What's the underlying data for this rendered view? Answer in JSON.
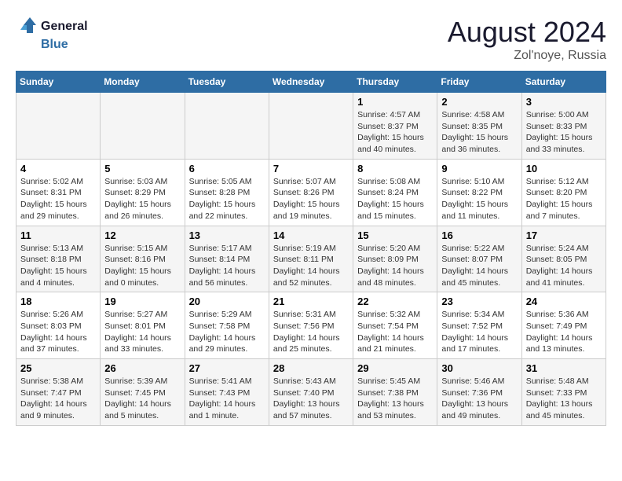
{
  "header": {
    "logo_line1": "General",
    "logo_line2": "Blue",
    "month_title": "August 2024",
    "subtitle": "Zol'noye, Russia"
  },
  "days_of_week": [
    "Sunday",
    "Monday",
    "Tuesday",
    "Wednesday",
    "Thursday",
    "Friday",
    "Saturday"
  ],
  "weeks": [
    [
      {
        "day": "",
        "info": ""
      },
      {
        "day": "",
        "info": ""
      },
      {
        "day": "",
        "info": ""
      },
      {
        "day": "",
        "info": ""
      },
      {
        "day": "1",
        "info": "Sunrise: 4:57 AM\nSunset: 8:37 PM\nDaylight: 15 hours\nand 40 minutes."
      },
      {
        "day": "2",
        "info": "Sunrise: 4:58 AM\nSunset: 8:35 PM\nDaylight: 15 hours\nand 36 minutes."
      },
      {
        "day": "3",
        "info": "Sunrise: 5:00 AM\nSunset: 8:33 PM\nDaylight: 15 hours\nand 33 minutes."
      }
    ],
    [
      {
        "day": "4",
        "info": "Sunrise: 5:02 AM\nSunset: 8:31 PM\nDaylight: 15 hours\nand 29 minutes."
      },
      {
        "day": "5",
        "info": "Sunrise: 5:03 AM\nSunset: 8:29 PM\nDaylight: 15 hours\nand 26 minutes."
      },
      {
        "day": "6",
        "info": "Sunrise: 5:05 AM\nSunset: 8:28 PM\nDaylight: 15 hours\nand 22 minutes."
      },
      {
        "day": "7",
        "info": "Sunrise: 5:07 AM\nSunset: 8:26 PM\nDaylight: 15 hours\nand 19 minutes."
      },
      {
        "day": "8",
        "info": "Sunrise: 5:08 AM\nSunset: 8:24 PM\nDaylight: 15 hours\nand 15 minutes."
      },
      {
        "day": "9",
        "info": "Sunrise: 5:10 AM\nSunset: 8:22 PM\nDaylight: 15 hours\nand 11 minutes."
      },
      {
        "day": "10",
        "info": "Sunrise: 5:12 AM\nSunset: 8:20 PM\nDaylight: 15 hours\nand 7 minutes."
      }
    ],
    [
      {
        "day": "11",
        "info": "Sunrise: 5:13 AM\nSunset: 8:18 PM\nDaylight: 15 hours\nand 4 minutes."
      },
      {
        "day": "12",
        "info": "Sunrise: 5:15 AM\nSunset: 8:16 PM\nDaylight: 15 hours\nand 0 minutes."
      },
      {
        "day": "13",
        "info": "Sunrise: 5:17 AM\nSunset: 8:14 PM\nDaylight: 14 hours\nand 56 minutes."
      },
      {
        "day": "14",
        "info": "Sunrise: 5:19 AM\nSunset: 8:11 PM\nDaylight: 14 hours\nand 52 minutes."
      },
      {
        "day": "15",
        "info": "Sunrise: 5:20 AM\nSunset: 8:09 PM\nDaylight: 14 hours\nand 48 minutes."
      },
      {
        "day": "16",
        "info": "Sunrise: 5:22 AM\nSunset: 8:07 PM\nDaylight: 14 hours\nand 45 minutes."
      },
      {
        "day": "17",
        "info": "Sunrise: 5:24 AM\nSunset: 8:05 PM\nDaylight: 14 hours\nand 41 minutes."
      }
    ],
    [
      {
        "day": "18",
        "info": "Sunrise: 5:26 AM\nSunset: 8:03 PM\nDaylight: 14 hours\nand 37 minutes."
      },
      {
        "day": "19",
        "info": "Sunrise: 5:27 AM\nSunset: 8:01 PM\nDaylight: 14 hours\nand 33 minutes."
      },
      {
        "day": "20",
        "info": "Sunrise: 5:29 AM\nSunset: 7:58 PM\nDaylight: 14 hours\nand 29 minutes."
      },
      {
        "day": "21",
        "info": "Sunrise: 5:31 AM\nSunset: 7:56 PM\nDaylight: 14 hours\nand 25 minutes."
      },
      {
        "day": "22",
        "info": "Sunrise: 5:32 AM\nSunset: 7:54 PM\nDaylight: 14 hours\nand 21 minutes."
      },
      {
        "day": "23",
        "info": "Sunrise: 5:34 AM\nSunset: 7:52 PM\nDaylight: 14 hours\nand 17 minutes."
      },
      {
        "day": "24",
        "info": "Sunrise: 5:36 AM\nSunset: 7:49 PM\nDaylight: 14 hours\nand 13 minutes."
      }
    ],
    [
      {
        "day": "25",
        "info": "Sunrise: 5:38 AM\nSunset: 7:47 PM\nDaylight: 14 hours\nand 9 minutes."
      },
      {
        "day": "26",
        "info": "Sunrise: 5:39 AM\nSunset: 7:45 PM\nDaylight: 14 hours\nand 5 minutes."
      },
      {
        "day": "27",
        "info": "Sunrise: 5:41 AM\nSunset: 7:43 PM\nDaylight: 14 hours\nand 1 minute."
      },
      {
        "day": "28",
        "info": "Sunrise: 5:43 AM\nSunset: 7:40 PM\nDaylight: 13 hours\nand 57 minutes."
      },
      {
        "day": "29",
        "info": "Sunrise: 5:45 AM\nSunset: 7:38 PM\nDaylight: 13 hours\nand 53 minutes."
      },
      {
        "day": "30",
        "info": "Sunrise: 5:46 AM\nSunset: 7:36 PM\nDaylight: 13 hours\nand 49 minutes."
      },
      {
        "day": "31",
        "info": "Sunrise: 5:48 AM\nSunset: 7:33 PM\nDaylight: 13 hours\nand 45 minutes."
      }
    ]
  ]
}
